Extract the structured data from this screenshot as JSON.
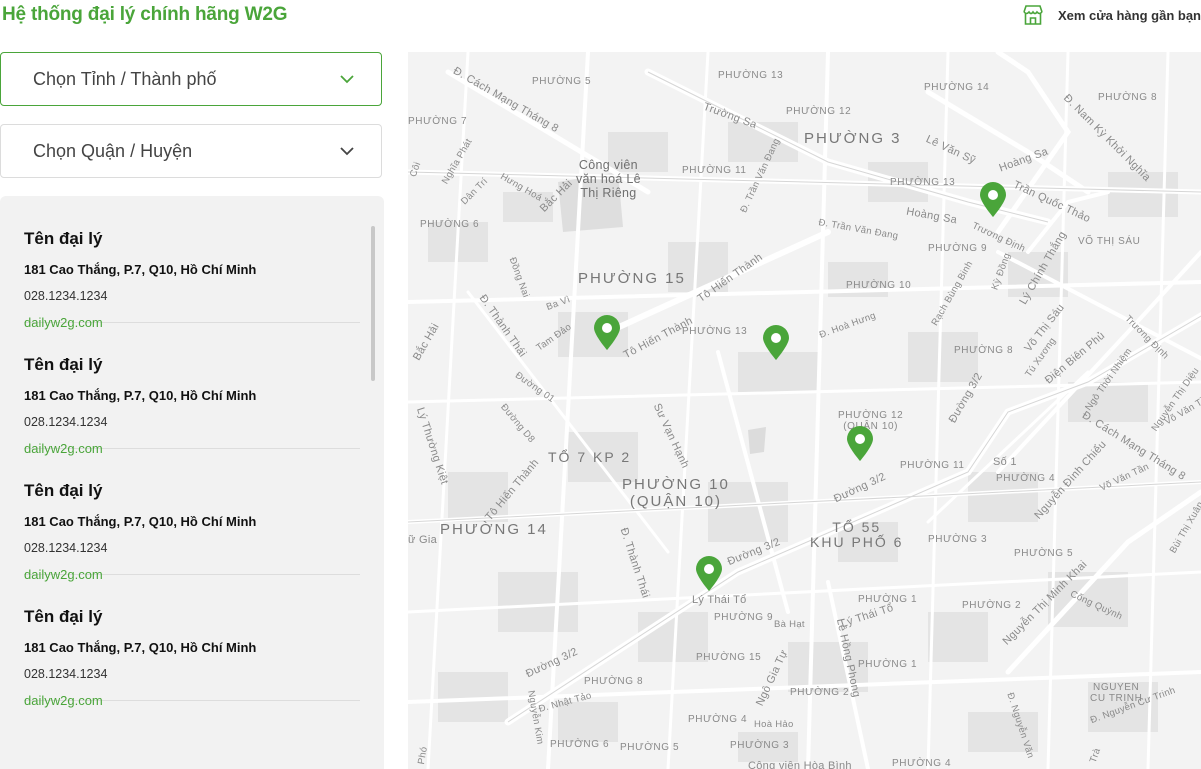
{
  "header": {
    "title": "Hệ thống đại lý chính hãng W2G",
    "nearby_label": "Xem cửa hàng gần bạn",
    "nearby_icon": "store-icon"
  },
  "filters": {
    "province_placeholder": "Chọn Tỉnh / Thành phố",
    "district_placeholder": "Chọn Quận / Huyện",
    "dropdown_icon": "chevron-down-icon"
  },
  "dealers": [
    {
      "name": "Tên đại lý",
      "address": "181 Cao Thắng, P.7, Q10, Hồ Chí Minh",
      "phone": "028.1234.1234",
      "website": "dailyw2g.com"
    },
    {
      "name": "Tên đại lý",
      "address": "181 Cao Thắng, P.7, Q10, Hồ Chí Minh",
      "phone": "028.1234.1234",
      "website": "dailyw2g.com"
    },
    {
      "name": "Tên đại lý",
      "address": "181 Cao Thắng, P.7, Q10, Hồ Chí Minh",
      "phone": "028.1234.1234",
      "website": "dailyw2g.com"
    },
    {
      "name": "Tên đại lý",
      "address": "181 Cao Thắng, P.7, Q10, Hồ Chí Minh",
      "phone": "028.1234.1234",
      "website": "dailyw2g.com"
    }
  ],
  "map": {
    "marker_icon": "map-pin-icon",
    "marker_color": "#4aa53a",
    "labels": {
      "phuong15": "PHƯỜNG 15",
      "phuong3": "PHƯỜNG 3",
      "phuong10q10": "PHƯỜNG 10\n(QUẬN 10)",
      "phuong14": "PHƯỜNG 14",
      "to7kp2": "TỔ 7 KP 2",
      "to55": "TỔ 55\nKHU PHỐ 6",
      "congvien": "Công viên\nvăn hoá Lê\nThị Riêng",
      "p5": "PHƯỜNG 5",
      "p13a": "PHƯỜNG 13",
      "p14": "PHƯỜNG 14",
      "p8a": "PHƯỜNG 8",
      "p7": "PHƯỜNG 7",
      "p12": "PHƯỜNG 12",
      "p11": "PHƯỜNG 11",
      "p13b": "PHƯỜNG 13",
      "p6": "PHƯỜNG 6",
      "p9": "PHƯỜNG 9",
      "p10": "PHƯỜNG 10",
      "p13c": "PHƯỜNG 13",
      "p8b": "PHƯỜNG 8",
      "p12q10": "PHƯỜNG 12\n(QUẬN 10)",
      "p11b": "PHƯỜNG 11",
      "p4": "PHƯỜNG 4",
      "p3": "PHƯỜNG 3",
      "p5b": "PHƯỜNG 5",
      "p1": "PHƯỜNG 1",
      "p2": "PHƯỜNG 2",
      "p9b": "PHƯỜNG 9",
      "p15": "PHƯỜNG 15",
      "p1b": "PHƯỜNG 1",
      "p8c": "PHƯỜNG 8",
      "p2b": "PHƯỜNG 2",
      "p4b": "PHƯỜNG 4",
      "p6b": "PHƯỜNG 6",
      "p5c": "PHƯỜNG 5",
      "p3b": "PHƯỜNG 3",
      "p4c": "PHƯỜNG 4",
      "votsau": "VÕ THỊ SÁU",
      "nguyencutrinh": "NGUYEN\nCU TRINH",
      "so1": "Số 1",
      "s_cmt8": "Đ. Cách Mạng Tháng 8",
      "s_truongsa": "Trường Sa",
      "s_levansy": "Lê Văn Sỹ",
      "s_hoangsa": "Hoàng Sa",
      "s_tranquocthao": "Trần Quốc Thảo",
      "s_nkkn": "Đ. Nam Kỳ Khởi Nghĩa",
      "s_hoangsa2": "Hoàng Sa",
      "s_tranvandang": "Đ. Trần Văn Đang",
      "s_tohienthanh": "Tô Hiến Thành",
      "s_tohienthanh2": "Tô Hiến Thành",
      "s_suvanhanh": "Sư Vạn Hạnh",
      "s_duong32": "Đường 3/2",
      "s_duong32b": "Đường 3/2",
      "s_duong32c": "Đường 3/2",
      "s_duong32d": "Đường 3/2",
      "s_thanhthai": "Đ. Thành Thái",
      "s_thanhthai2": "Đ. Thành Thái",
      "s_lythaito": "Lý Thái Tổ",
      "s_lythaito2": "Lý Thái Tổ",
      "s_lehongphong": "Lê Hồng Phong",
      "s_ngogiatu": "Ngô Gia Tự",
      "s_nguyenthiminhkhai": "Nguyễn Thị Minh Khai",
      "s_dienbienphu": "Điện Biên Phủ",
      "s_cmt8b": "Đ. Cách Mạng Tháng 8",
      "s_nguyendinhchieu": "Nguyễn Đình Chiểu",
      "s_lychinhthang": "Lý Chính Thắng",
      "s_vothisau": "Võ Thị Sáu",
      "s_lythuongkiet": "Lý Thường Kiệt",
      "s_bachai": "Bắc Hải",
      "s_bachai2": "Bắc Hải",
      "s_tohienthanh3": "Tô Hiến Thành",
      "s_dongnai": "Đồng Nai",
      "s_tamdao": "Tam Đảo",
      "s_bavi": "Ba Vì",
      "s_duong01": "Đường 01",
      "s_duongd8": "Đường D8",
      "s_hoahung": "Đ. Hoà Hưng",
      "s_tranvandang2": "Đ. Trần Văn Đang",
      "s_nhattao": "Đ. Nhật Tảo",
      "s_nguyenkim": "Nguyễn Kim",
      "s_bahat": "Bà Hạt",
      "s_hoahao": "Hoà Hảo",
      "s_congquynh": "Cống Quỳnh",
      "s_nguyencutrinh": "Đ. Nguyễn Cư Trinh",
      "s_nguyenvan": "Đ. Nguyễn Văn",
      "s_rachbungbinh": "Rạch Bùng Binh",
      "s_kydong": "Kỳ Đồng",
      "s_truongdinh": "Trương Định",
      "s_truongdinh2": "Trương Định",
      "s_tuxuong": "Tú Xương",
      "s_ngothoinhiem": "Ngô Thời Nhiệm",
      "s_nguyenthidieu": "Nguyễn Thị Diệu",
      "s_vovantan": "Võ Văn Tần",
      "s_vovantan2": "Võ Văn Tần",
      "s_buithixuan": "Bùi Thị Xuân",
      "s_nghiaphat": "Nghĩa Phát",
      "s_dantri": "Dân Trí",
      "s_hunghoa": "Hưng Hoá",
      "s_coi": "Côi",
      "s_giang": "ữ Gia",
      "s_pho": "Phó",
      "s_tra": "Trà",
      "s_congvienhoabinh": "Công viên Hòa Bình"
    }
  }
}
